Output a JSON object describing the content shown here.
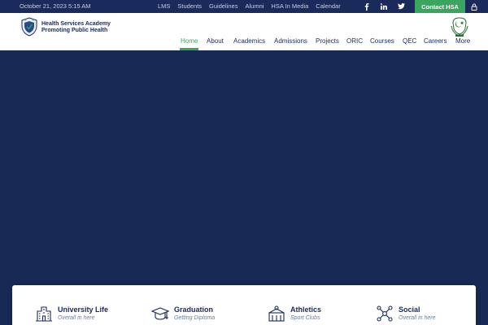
{
  "topbar": {
    "datetime": "October 21, 2023 5:15 AM",
    "links": [
      "LMS",
      "Students",
      "Guidelines",
      "Alumni",
      "HSA In Media",
      "Calendar"
    ],
    "social_icons": [
      "facebook-icon",
      "linkedin-icon",
      "twitter-icon",
      "instagram-icon"
    ],
    "contact_label": "Contact HSA"
  },
  "header": {
    "brand_line1": "Health Services Academy",
    "brand_line2": "Promoting Public Health"
  },
  "nav": {
    "items": [
      "Home",
      "About",
      "Academics",
      "Admissions",
      "Projects",
      "ORIC",
      "Courses",
      "QEC",
      "Careers",
      "More"
    ],
    "active": "Home"
  },
  "features": [
    {
      "title": "University Life",
      "subtitle": "Overall in here",
      "icon": "building-icon"
    },
    {
      "title": "Graduation",
      "subtitle": "Getting Diploma",
      "icon": "graduation-cap-icon"
    },
    {
      "title": "Athletics",
      "subtitle": "Sport Clubs",
      "icon": "athletics-icon"
    },
    {
      "title": "Social",
      "subtitle": "Overall in here",
      "icon": "network-icon"
    }
  ],
  "colors": {
    "navy": "#172a55",
    "topbar": "#1a2a5a",
    "accent_green": "#39a55f"
  }
}
